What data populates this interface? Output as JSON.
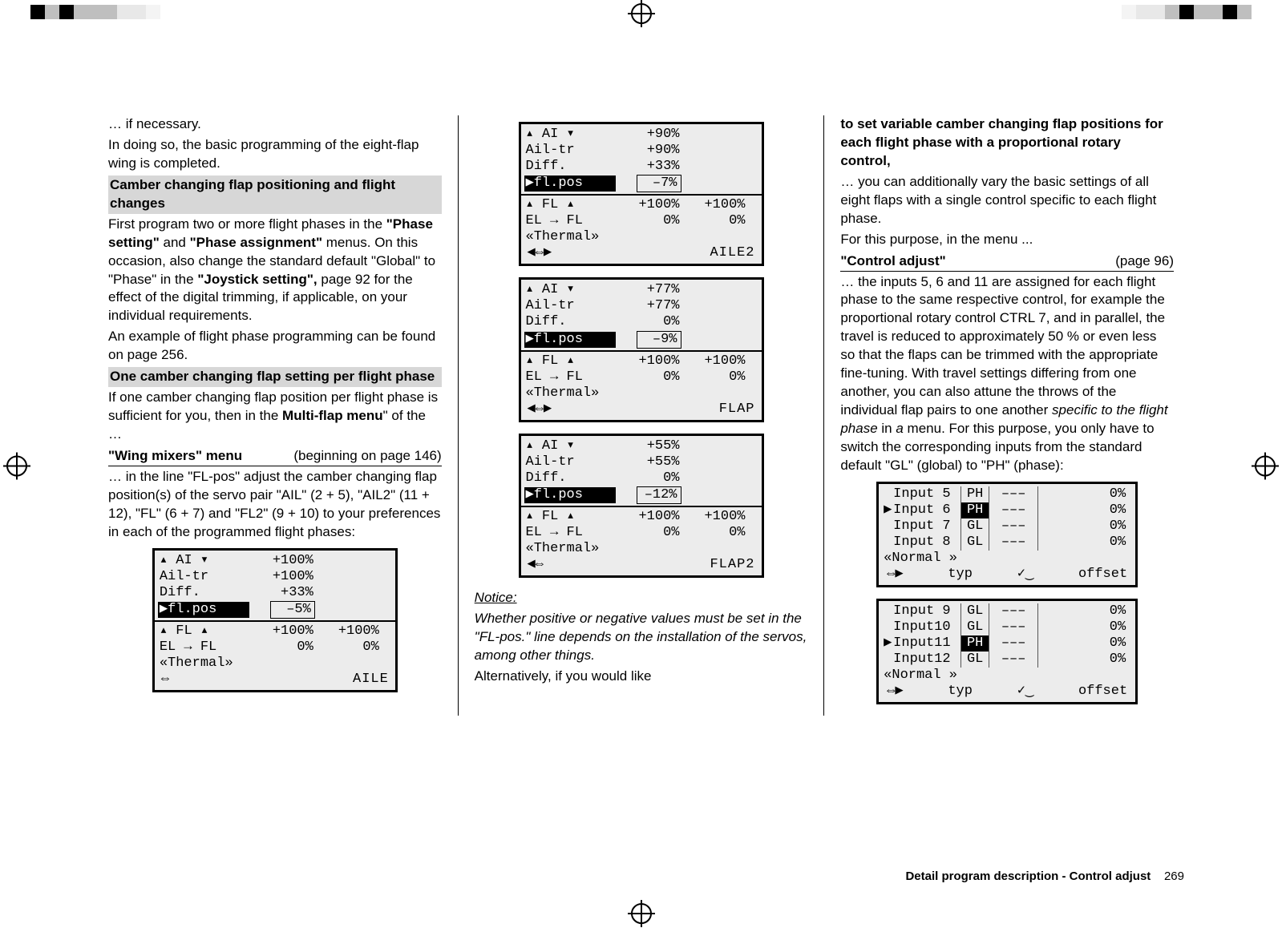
{
  "col1": {
    "p1": "… if necessary.",
    "p2a": "In doing so, the basic programming of the eight-flap wing is completed.",
    "h1": "Camber changing flap positioning and flight changes",
    "p3a": "First program two or more flight phases in the ",
    "p3b": "\"Phase setting\"",
    "p3c": " and ",
    "p3d": "\"Phase assignment\"",
    "p3e": " menus. On this occasion, also change the standard default \"Global\" to \"Phase\" in the ",
    "p3f": "\"Joystick setting\",",
    "p3g": " page 92 for the effect of the digital trimming, if applicable, on your individual requirements.",
    "p4": "An example of flight phase programming can be found on page 256.",
    "h2": "One camber changing flap setting per flight phase",
    "p5a": "If one camber changing flap position per flight phase is sufficient for you, then in the ",
    "p5b": "Multi-flap menu",
    "p5c": "\" of the …",
    "wm_l": "\"Wing mixers\" menu",
    "wm_r": "(beginning on page 146)",
    "p6": "… in the line \"FL-pos\" adjust the camber changing flap position(s) of the servo pair \"AIL\" (2 + 5), \"AIL2\" (11 + 12), \"FL\" (6 + 7) and \"FL2\" (9 + 10) to your preferences in each of the programmed flight phases:"
  },
  "col2": {
    "notice_t": "Notice:",
    "notice_b": "Whether positive or negative values must be set in the \"FL-pos.\" line depends on the installation of the servos, among  other things.",
    "alt": "Alternatively, if you would like"
  },
  "col3": {
    "intro1": "to set variable camber changing flap positions for each flight phase with a proportional rotary control,",
    "intro2": "… you can additionally vary the basic settings of all eight flaps with a single control specific to each flight phase.",
    "intro3": "For this purpose, in the menu ...",
    "ca_l": "\"Control adjust\"",
    "ca_r": "(page 96)",
    "body1a": "… the inputs 5, 6 and 11 are assigned for each flight phase to the same respective control, for example the proportional rotary control CTRL 7, and in parallel, the travel is reduced to approximately 50 % or even less so that the flaps can be trimmed with the appropriate fine-tuning. With travel settings differing from one another, you can also attune the throws of the individual flap pairs to one another ",
    "body1b": "specific to the flight phase",
    "body1c": " in ",
    "body1d": "a",
    "body1e": " menu. For this purpose, you only have to switch the corresponding inputs from the standard default \"GL\" (global) to \"PH\" (phase):"
  },
  "panels": {
    "labels": {
      "ai": "▴ AI ▾",
      "ailtr": "Ail-tr",
      "diff": "Diff.",
      "flpos": "▶fl.pos",
      "fl": "▴ FL ▴",
      "elfl": "EL → FL",
      "phase": "«Thermal»",
      "navL": "⇔",
      "navR": "◀⇔▶",
      "navLR": "◀⇔"
    },
    "p1": {
      "ai": "+100%",
      "ailtr": "+100%",
      "diff": "+33%",
      "flpos": "–5%",
      "fl1": "+100%",
      "fl2": "+100%",
      "el1": "0%",
      "el2": "0%",
      "tag": "AILE"
    },
    "p2": {
      "ai": "+90%",
      "ailtr": "+90%",
      "diff": "+33%",
      "flpos": "–7%",
      "fl1": "+100%",
      "fl2": "+100%",
      "el1": "0%",
      "el2": "0%",
      "tag": "AILE2"
    },
    "p3": {
      "ai": "+77%",
      "ailtr": "+77%",
      "diff": "0%",
      "flpos": "–9%",
      "fl1": "+100%",
      "fl2": "+100%",
      "el1": "0%",
      "el2": "0%",
      "tag": "FLAP"
    },
    "p4": {
      "ai": "+55%",
      "ailtr": "+55%",
      "diff": "0%",
      "flpos": "–12%",
      "fl1": "+100%",
      "fl2": "+100%",
      "el1": "0%",
      "el2": "0%",
      "tag": "FLAP2"
    }
  },
  "inputs": {
    "phase": "«Normal »",
    "foot_typ": "typ",
    "foot_off": "offset",
    "nav": "⇔▶",
    "curve": "✓‿",
    "dash": "–––",
    "a": [
      {
        "sel": " ",
        "n": "Input  5",
        "ph": "PH",
        "inv": false,
        "val": "0%"
      },
      {
        "sel": "▶",
        "n": "Input  6",
        "ph": "PH",
        "inv": true,
        "val": "0%"
      },
      {
        "sel": " ",
        "n": "Input  7",
        "ph": "GL",
        "inv": false,
        "val": "0%"
      },
      {
        "sel": " ",
        "n": "Input  8",
        "ph": "GL",
        "inv": false,
        "val": "0%"
      }
    ],
    "b": [
      {
        "sel": " ",
        "n": "Input  9",
        "ph": "GL",
        "inv": false,
        "val": "0%"
      },
      {
        "sel": " ",
        "n": "Input10",
        "ph": "GL",
        "inv": false,
        "val": "0%"
      },
      {
        "sel": "▶",
        "n": "Input11",
        "ph": "PH",
        "inv": true,
        "val": "0%"
      },
      {
        "sel": " ",
        "n": "Input12",
        "ph": "GL",
        "inv": false,
        "val": "0%"
      }
    ]
  },
  "footer": {
    "section": "Detail program description - Control adjust",
    "page": "269"
  }
}
